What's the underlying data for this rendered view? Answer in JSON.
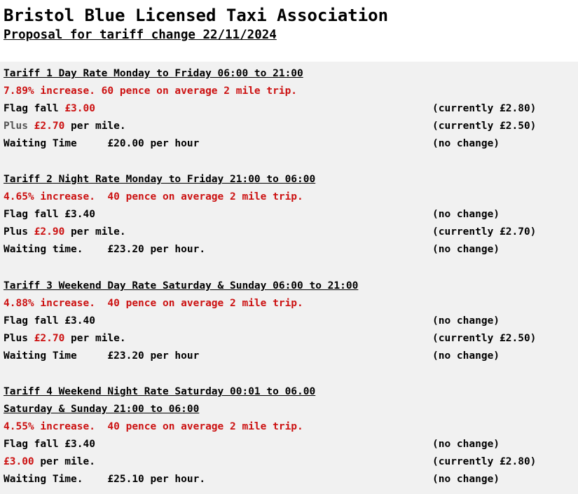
{
  "header": {
    "title": "Bristol Blue Licensed Taxi Association",
    "subtitle": "Proposal for tariff change 22/11/2024"
  },
  "tariffs": [
    {
      "heading": "Tariff 1 Day Rate Monday to Friday 06:00 to 21:00",
      "increase": "7.89% increase.  60 pence on average 2 mile trip.",
      "flag_label": "Flag fall ",
      "flag_value": "£3.00",
      "flag_note": "(currently £2.80)",
      "mile_prefix": "Plus ",
      "mile_value": "£2.70",
      "mile_suffix": " per mile.",
      "mile_note": "(currently £2.50)",
      "wait_text": "Waiting Time     £20.00 per hour",
      "wait_note": "(no change)"
    },
    {
      "heading": "Tariff 2 Night Rate Monday to Friday 21:00 to 06:00",
      "increase": "4.65% increase.  40 pence on average 2 mile trip.",
      "flag_text": "Flag fall £3.40",
      "flag_note": "(no change)",
      "mile_prefix": "Plus ",
      "mile_value": "£2.90",
      "mile_suffix": " per mile.",
      "mile_note": "(currently £2.70)",
      "wait_text": "Waiting time.    £23.20 per hour.",
      "wait_note": "(no change)"
    },
    {
      "heading": "Tariff 3 Weekend Day Rate Saturday & Sunday 06:00 to 21:00",
      "increase": "4.88% increase.  40 pence on average 2 mile trip.",
      "flag_text": "Flag fall £3.40",
      "flag_note": "(no change)",
      "mile_prefix": "Plus ",
      "mile_value": "£2.70",
      "mile_suffix": " per mile.",
      "mile_note": "(currently £2.50)",
      "wait_text": "Waiting Time     £23.20 per hour",
      "wait_note": "(no change)"
    },
    {
      "heading": "Tariff 4 Weekend Night Rate Saturday 00:01 to 06.00",
      "heading2": "Saturday & Sunday 21:00 to 06:00",
      "increase": "4.55% increase.  40 pence on average 2 mile trip.",
      "flag_text": "Flag fall £3.40",
      "flag_note": "(no change)",
      "mile_value": "£3.00",
      "mile_suffix": " per mile.",
      "mile_note": "(currently £2.80)",
      "wait_text": "Waiting Time.    £25.10 per hour.",
      "wait_note": "(no change)"
    }
  ]
}
